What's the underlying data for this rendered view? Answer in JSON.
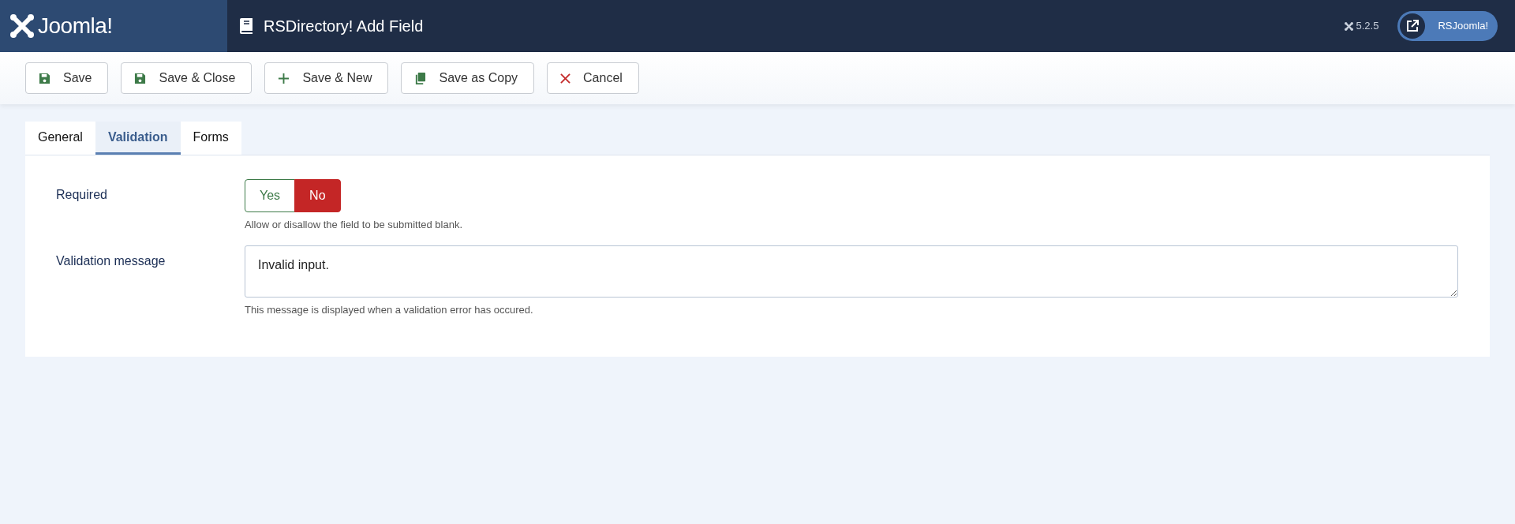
{
  "header": {
    "logo_text": "Joomla!",
    "title": "RSDirectory! Add Field",
    "version": "5.2.5",
    "user_button": "RSJoomla!"
  },
  "toolbar": [
    {
      "label": "Save",
      "kind": "save"
    },
    {
      "label": "Save & Close",
      "kind": "save"
    },
    {
      "label": "Save & New",
      "kind": "new"
    },
    {
      "label": "Save as Copy",
      "kind": "copy"
    },
    {
      "label": "Cancel",
      "kind": "cancel"
    }
  ],
  "tabs": [
    {
      "label": "General",
      "selected": false
    },
    {
      "label": "Validation",
      "selected": true
    },
    {
      "label": "Forms",
      "selected": false
    }
  ],
  "fields": [
    {
      "kind": "switcher",
      "label": "Required",
      "options": [
        {
          "label": "Yes",
          "selected": false,
          "kind": "yes"
        },
        {
          "label": "No",
          "selected": true,
          "kind": "no"
        }
      ],
      "help": "Allow or disallow the field to be submitted blank."
    },
    {
      "kind": "textarea",
      "label": "Validation message",
      "value": "Invalid input.",
      "help": "This message is displayed when a validation error has occured."
    }
  ]
}
